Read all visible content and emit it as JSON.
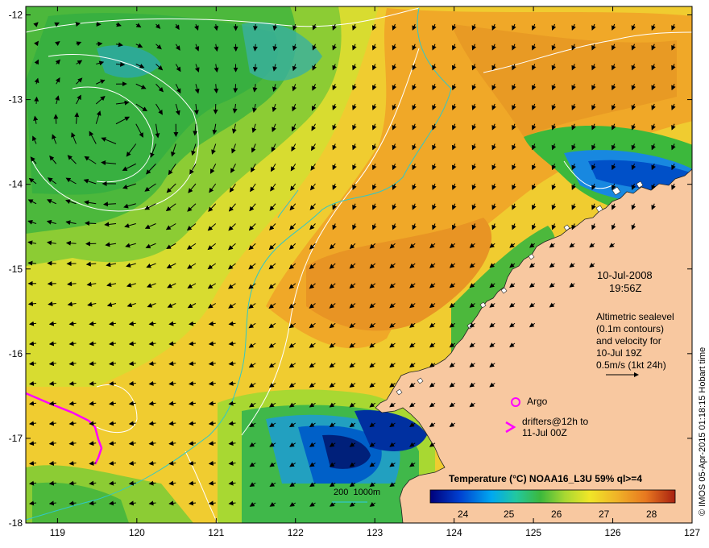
{
  "map": {
    "date": "10-Jul-2008",
    "time": "19:56Z",
    "altimetry_text": [
      "Altimetric sealevel",
      "(0.1m contours)",
      "and velocity for",
      "10-Jul 19Z",
      "0.5m/s (1kt 24h)"
    ],
    "argo_label": "Argo",
    "drifters_text": [
      "drifters@12h to",
      "11-Jul 00Z"
    ],
    "depth_legend": "200  1000m",
    "colorbar_title": "Temperature (°C) NOAA16_L3U 59% ql>=4",
    "colorbar_ticks": [
      "24",
      "25",
      "26",
      "27",
      "28"
    ],
    "credit": "© IMOS 05-Apr-2015 01:18:15 Hobart time",
    "lon_labels": [
      "119",
      "120",
      "121",
      "122",
      "123",
      "124",
      "125",
      "126",
      "127"
    ],
    "lat_labels": [
      "-12",
      "-13",
      "-14",
      "-15",
      "-16",
      "-17",
      "-18"
    ]
  },
  "chart_data": {
    "type": "heatmap",
    "xlim": [
      118.6,
      127
    ],
    "ylim": [
      -18,
      -11.9
    ],
    "colorbar_range": [
      23.5,
      28.8
    ],
    "colormap": [
      "#00007a",
      "#0044d0",
      "#00a8f0",
      "#22c8a8",
      "#3cb83c",
      "#a8d832",
      "#f0e628",
      "#f0b428",
      "#e87820",
      "#b83010"
    ],
    "land_color": "#f8c8a0",
    "contour_colors": {
      "sealevel": "#ffffff",
      "depth_200": "#30c8c8"
    },
    "marker_color": "#ff00ff"
  }
}
